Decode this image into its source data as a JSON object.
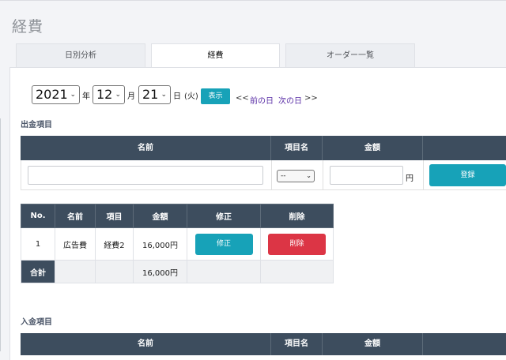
{
  "page": {
    "title": "経費"
  },
  "tabs": [
    {
      "label": "日別分析"
    },
    {
      "label": "経費"
    },
    {
      "label": "オーダー一覧"
    }
  ],
  "date": {
    "year": "2021",
    "year_unit": "年",
    "month": "12",
    "month_unit": "月",
    "day": "21",
    "day_unit": "日",
    "weekday": "(火)",
    "show_button": "表示",
    "prev_arrows": "<<",
    "prev_day": "前の日",
    "next_day": "次の日",
    "next_arrows": ">>"
  },
  "expense_section": {
    "label": "出金項目",
    "headers": {
      "name": "名前",
      "item": "項目名",
      "amount": "金額"
    },
    "form": {
      "item_select": "--",
      "yen_unit": "円",
      "register_button": "登録"
    }
  },
  "expense_table": {
    "headers": [
      "No.",
      "名前",
      "項目",
      "金額",
      "修正",
      "削除"
    ],
    "rows": [
      {
        "no": "1",
        "name": "広告費",
        "item": "経費2",
        "amount": "16,000円",
        "edit": "修正",
        "delete": "削除"
      }
    ],
    "total": {
      "label": "合計",
      "amount": "16,000円"
    }
  },
  "income_section": {
    "label": "入金項目",
    "headers": {
      "name": "名前",
      "item": "項目名",
      "amount": "金額"
    }
  },
  "colors": {
    "header_bg": "#3d4d5e",
    "teal": "#17a2b8",
    "red": "#dc3545",
    "link": "#5a2ea6"
  }
}
